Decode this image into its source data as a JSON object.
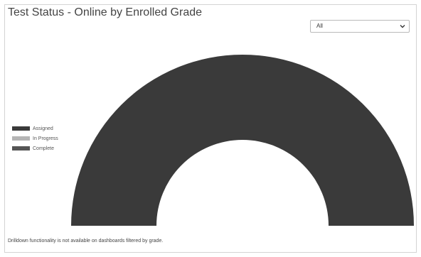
{
  "panel": {
    "title": "Test Status - Online by Enrolled Grade",
    "footnote": "Drilldown functionality is not available on dashboards filtered by grade."
  },
  "grade_filter": {
    "selected": "All",
    "icon": "chevron-down-icon"
  },
  "legend": {
    "items": [
      {
        "label": "Assigned",
        "color": "#3a3a3a"
      },
      {
        "label": "In Progress",
        "color": "#b5b5b5"
      },
      {
        "label": "Complete",
        "color": "#555555"
      }
    ]
  },
  "chart_data": {
    "type": "pie",
    "variant": "semicircle-donut",
    "legend_placement": "left",
    "series": [
      {
        "name": "Assigned",
        "value": 100,
        "color": "#3a3a3a"
      },
      {
        "name": "In Progress",
        "value": 0,
        "color": "#b5b5b5"
      },
      {
        "name": "Complete",
        "value": 0,
        "color": "#555555"
      }
    ]
  }
}
